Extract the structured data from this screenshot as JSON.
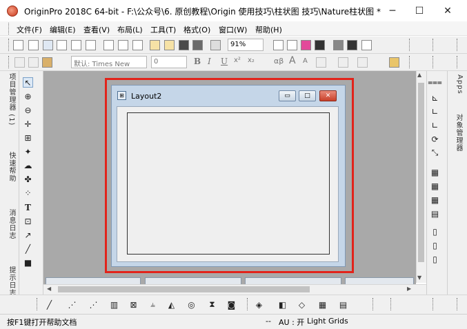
{
  "window": {
    "title": "OriginPro 2018C 64-bit - F:\\公众号\\6. 原创教程\\Origin 使用技巧\\柱状图 技巧\\Nature柱状图 * - /Fo...",
    "minimize_glyph": "─",
    "maximize_glyph": "☐",
    "close_glyph": "✕"
  },
  "menu": {
    "items": [
      "文件(F)",
      "编辑(E)",
      "查看(V)",
      "布局(L)",
      "工具(T)",
      "格式(O)",
      "窗口(W)",
      "帮助(H)"
    ]
  },
  "toolbar": {
    "zoom_value": "91%",
    "font_value": "默认: Times New",
    "size_value": "0",
    "bold_label": "B",
    "italic_label": "I",
    "underline_label": "U",
    "super_label": "x²",
    "sub_label": "x₂",
    "greek_label": "αβ",
    "font_big_label": "A",
    "font_small_label": "A"
  },
  "left_dock": {
    "tabs": [
      "项目管理器 (1)",
      "快速帮助",
      "消息日志",
      "提示日志"
    ]
  },
  "right_dock": {
    "tabs": [
      "Apps",
      "对象管理器"
    ]
  },
  "layout_window": {
    "title": "Layout2",
    "icon_glyph": "⊞",
    "minimize_glyph": "▭",
    "maximize_glyph": "□",
    "close_glyph": "✕"
  },
  "status": {
    "help_text": "按F1键打开帮助文档",
    "separator_text": "--",
    "au_text": "AU : 开",
    "grid_text": "Light Grids"
  },
  "colors": {
    "highlight": "#e2231a",
    "workspace": "#a9a9a9",
    "layout_frame": "#c5d6e8",
    "close_button": "#d9503a"
  }
}
